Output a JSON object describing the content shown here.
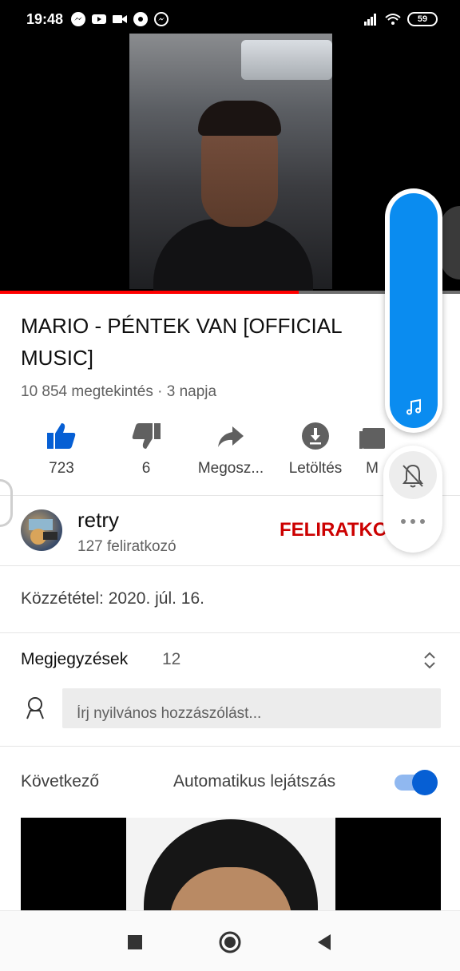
{
  "status_bar": {
    "time": "19:48",
    "battery": "59",
    "icons": [
      "messenger-icon",
      "youtube-icon",
      "video-call-icon",
      "football-icon",
      "messenger-icon",
      "signal-icon",
      "wifi-icon",
      "battery-icon"
    ]
  },
  "video": {
    "progress": 0.65,
    "progress_color": "#ff0000"
  },
  "title": "MARIO - PÉNTEK VAN [OFFICIAL MUSIC]",
  "meta": "10 854 megtekintés · 3 napja",
  "actions": {
    "like_count": "723",
    "dislike_count": "6",
    "share_label": "Megosz...",
    "download_label": "Letöltés",
    "save_label": "M"
  },
  "channel": {
    "name": "retry",
    "subscribers": "127 feliratkozó",
    "subscribe_label": "FELIRATKOZÁS"
  },
  "published": "Közzététel: 2020. júl. 16.",
  "comments": {
    "title": "Megjegyzések",
    "count": "12",
    "input_placeholder": "Írj nyilvános hozzászólást..."
  },
  "up_next": {
    "label": "Következő",
    "autoplay_label": "Automatikus lejátszás",
    "autoplay_on": true
  },
  "colors": {
    "accent_blue": "#065fd4",
    "subscribe_red": "#cc0000",
    "float_blue": "#0a8cf0"
  }
}
